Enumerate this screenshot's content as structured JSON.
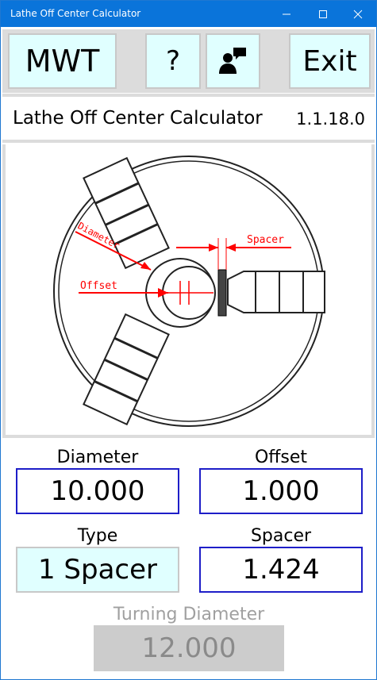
{
  "window": {
    "title": "Lathe Off Center Calculator"
  },
  "toolbar": {
    "mwt_label": "MWT",
    "help_label": "?",
    "exit_label": "Exit"
  },
  "header": {
    "app_title": "Lathe Off Center Calculator",
    "version": "1.1.18.0"
  },
  "diagram": {
    "label_diameter": "Diameter",
    "label_offset": "Offset",
    "label_spacer": "Spacer",
    "accent_color": "#ff0000"
  },
  "inputs": {
    "diameter_label": "Diameter",
    "diameter_value": "10.000",
    "offset_label": "Offset",
    "offset_value": "1.000",
    "type_label": "Type",
    "type_value": "1 Spacer",
    "spacer_label": "Spacer",
    "spacer_value": "1.424"
  },
  "result": {
    "label": "Turning Diameter",
    "value": "12.000"
  }
}
